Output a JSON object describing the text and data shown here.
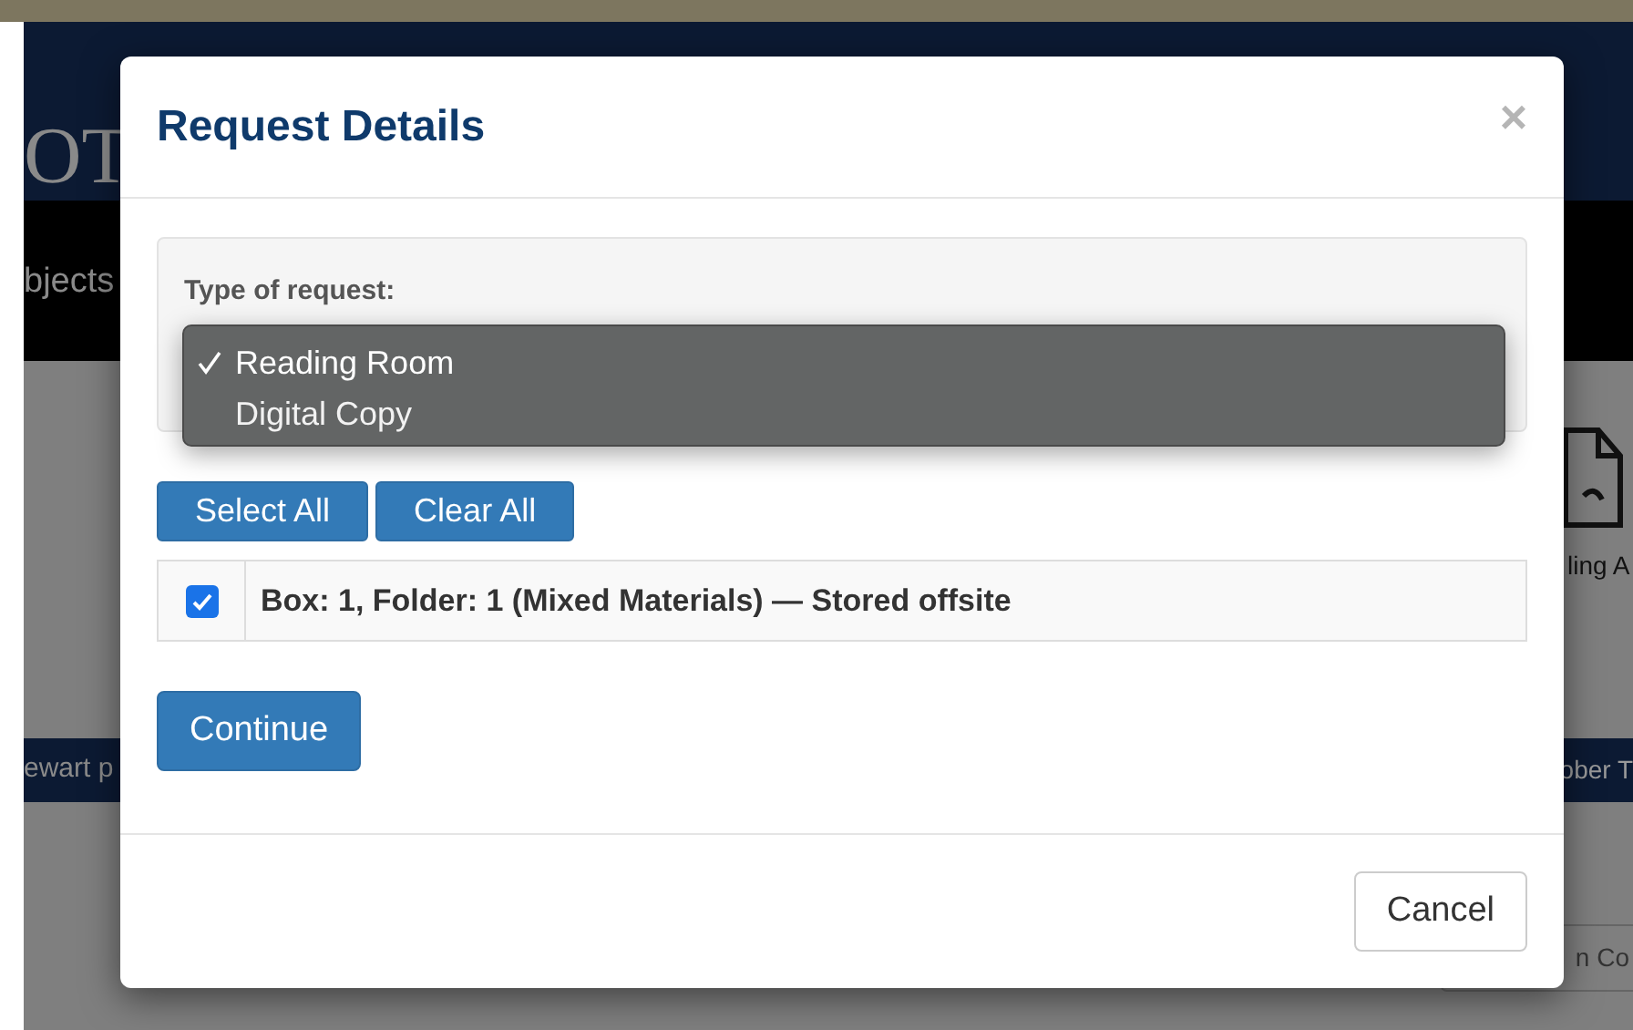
{
  "background": {
    "logo_text": "OT",
    "nav_text": "bjects",
    "side_label": "ling A",
    "band_left": "ewart p",
    "band_right": "ober T",
    "corner_text": "n Co"
  },
  "modal": {
    "title": "Request Details",
    "close": "×",
    "request_type": {
      "label": "Type of request:",
      "options": [
        {
          "label": "Reading Room",
          "selected": true
        },
        {
          "label": "Digital Copy",
          "selected": false
        }
      ]
    },
    "buttons": [
      "Select All",
      "Clear All"
    ],
    "items": [
      {
        "label": "Box: 1, Folder: 1 (Mixed Materials) — Stored offsite",
        "checked": true
      }
    ],
    "continue": "Continue",
    "cancel": "Cancel"
  }
}
